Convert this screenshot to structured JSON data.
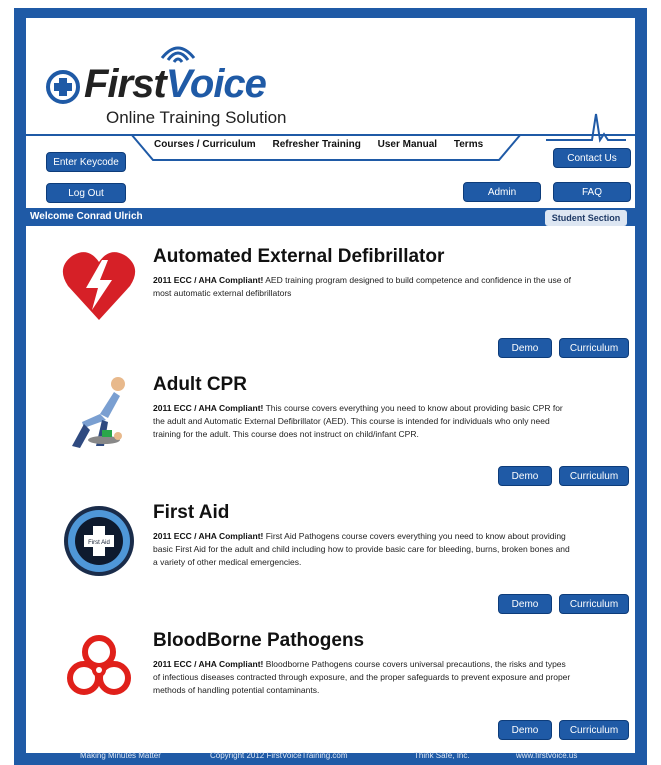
{
  "brand": {
    "first": "First",
    "voice": "Voice",
    "tagline": "Online Training Solution"
  },
  "nav": [
    "Courses / Curriculum",
    "Refresher Training",
    "User Manual",
    "Terms"
  ],
  "buttons": {
    "enter_keycode": "Enter Keycode",
    "logout": "Log Out",
    "contact": "Contact Us",
    "admin": "Admin",
    "faq": "FAQ",
    "student_section": "Student Section"
  },
  "welcome": "Welcome Conrad Ulrich",
  "courses": [
    {
      "title": "Automated External Defibrillator",
      "compliant": "2011 ECC / AHA Compliant!",
      "desc": " AED training program designed to build competence and confidence in the use of most automatic external defibrillators",
      "demo": "Demo",
      "curriculum": "Curriculum",
      "icon": "heart-defibrillator-icon"
    },
    {
      "title": "Adult CPR",
      "compliant": "2011 ECC / AHA Compliant!",
      "desc": " This course covers everything you need to know about providing basic CPR for the adult and Automatic External Defibrillator (AED). This course is intended for individuals who only need training for the adult. This course does not instruct on child/infant CPR.",
      "demo": "Demo",
      "curriculum": "Curriculum",
      "icon": "cpr-person-icon"
    },
    {
      "title": "First Aid",
      "compliant": "2011 ECC / AHA Compliant!",
      "desc": " First Aid Pathogens course covers everything you need to know about providing basic First Aid for the adult and child including how to provide basic care for bleeding, burns, broken bones and a variety of other medical emergencies.",
      "demo": "Demo",
      "curriculum": "Curriculum",
      "icon": "first-aid-badge-icon",
      "badge_text": "First Aid"
    },
    {
      "title": "BloodBorne Pathogens",
      "compliant": "2011 ECC / AHA Compliant!",
      "desc": " Bloodborne Pathogens course covers universal precautions, the risks and types of infectious diseases contracted through exposure, and the proper safeguards to prevent exposure and proper methods of handling potential contaminants.",
      "demo": "Demo",
      "curriculum": "Curriculum",
      "icon": "biohazard-icon"
    }
  ],
  "footer": [
    "Making Minutes Matter",
    "Copyright 2012 FirstVoiceTraining.com",
    "Think Safe, Inc.",
    "www.firstvoice.us"
  ],
  "colors": {
    "primary": "#1f5aa6",
    "heart_red": "#d62027",
    "biohazard_red": "#e0201a"
  }
}
